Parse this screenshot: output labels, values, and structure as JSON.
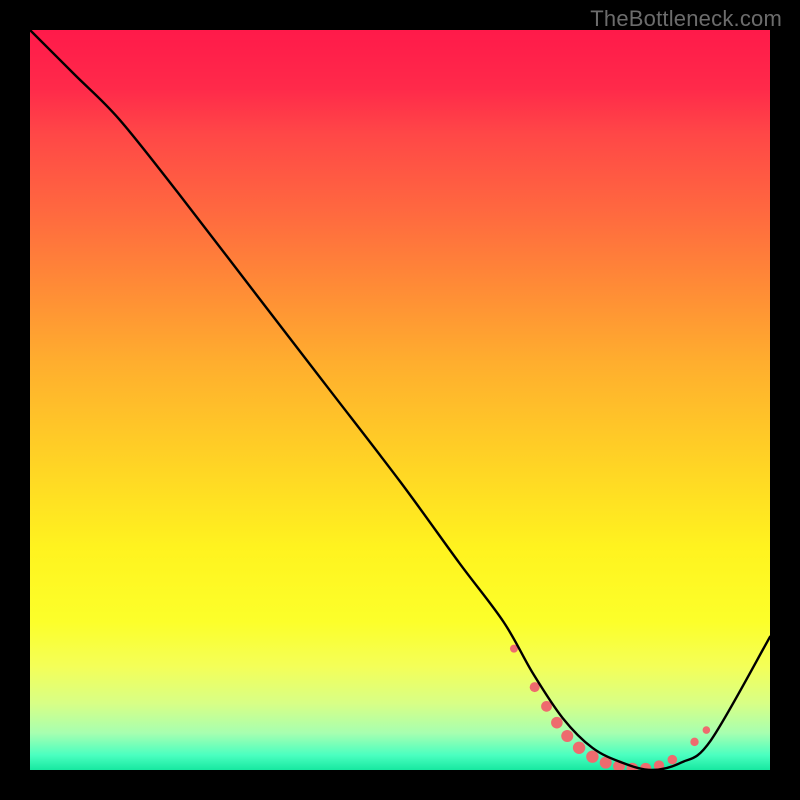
{
  "watermark": "TheBottleneck.com",
  "chart_data": {
    "type": "line",
    "title": "",
    "xlabel": "",
    "ylabel": "",
    "xlim": [
      0,
      100
    ],
    "ylim": [
      0,
      100
    ],
    "grid": false,
    "legend": false,
    "curve": {
      "x": [
        0,
        6,
        12,
        20,
        30,
        40,
        50,
        58,
        64,
        68,
        72,
        76,
        80,
        84,
        88,
        92,
        100
      ],
      "y": [
        100,
        94,
        88,
        78,
        65,
        52,
        39,
        28,
        20,
        13,
        7,
        3,
        1,
        0,
        1,
        4,
        18
      ]
    },
    "markers": {
      "color": "#ee6b6e",
      "points": [
        {
          "x": 65.4,
          "y": 16.4,
          "r": 4.0
        },
        {
          "x": 68.2,
          "y": 11.2,
          "r": 5.0
        },
        {
          "x": 69.8,
          "y": 8.6,
          "r": 5.4
        },
        {
          "x": 71.2,
          "y": 6.4,
          "r": 5.8
        },
        {
          "x": 72.6,
          "y": 4.6,
          "r": 6.0
        },
        {
          "x": 74.2,
          "y": 3.0,
          "r": 6.2
        },
        {
          "x": 76.0,
          "y": 1.8,
          "r": 6.2
        },
        {
          "x": 77.8,
          "y": 1.0,
          "r": 6.0
        },
        {
          "x": 79.6,
          "y": 0.5,
          "r": 6.0
        },
        {
          "x": 81.4,
          "y": 0.2,
          "r": 5.8
        },
        {
          "x": 83.2,
          "y": 0.2,
          "r": 5.6
        },
        {
          "x": 85.0,
          "y": 0.6,
          "r": 5.2
        },
        {
          "x": 86.8,
          "y": 1.4,
          "r": 4.8
        },
        {
          "x": 89.8,
          "y": 3.8,
          "r": 4.2
        },
        {
          "x": 91.4,
          "y": 5.4,
          "r": 3.8
        }
      ]
    }
  }
}
